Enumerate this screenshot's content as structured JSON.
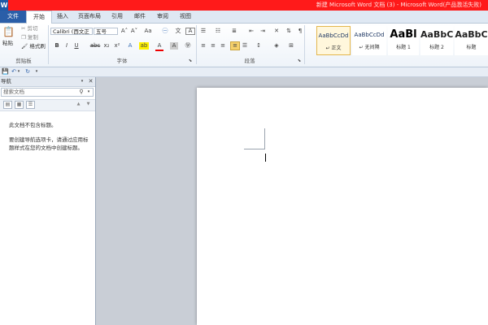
{
  "window": {
    "title": "新建 Microsoft Word 文档 (3) - Microsoft Word(产品激活失败)",
    "app_icon": "W"
  },
  "tabs": [
    "文件",
    "开始",
    "插入",
    "页面布局",
    "引用",
    "邮件",
    "审阅",
    "视图"
  ],
  "ribbon": {
    "clipboard": {
      "paste": "粘贴",
      "cut": "剪切",
      "copy": "复制",
      "format_painter": "格式刷",
      "group": "剪贴板"
    },
    "font": {
      "name": "Calibri (西文正",
      "size": "五号",
      "grow": "A˄",
      "shrink": "A˅",
      "case": "Aa",
      "clear": "A",
      "bold": "B",
      "italic": "I",
      "underline": "U",
      "strike": "abc",
      "sub": "x₂",
      "sup": "x²",
      "effects": "A",
      "highlight": "ab",
      "color": "A",
      "char_shade": "A",
      "group": "字体"
    },
    "paragraph": {
      "group": "段落"
    },
    "styles": [
      {
        "sample": "AaBbCcDd",
        "name": "↵ 正文"
      },
      {
        "sample": "AaBbCcDd",
        "name": "↵ 无间隔"
      },
      {
        "sample": "AaBl",
        "name": "标题 1"
      },
      {
        "sample": "AaBbC",
        "name": "标题 2"
      },
      {
        "sample": "AaBbC",
        "name": "标题"
      }
    ]
  },
  "nav": {
    "title": "导航",
    "search_placeholder": "搜索文档",
    "message1": "此文档不包含标题。",
    "message2": "要创建导航选项卡，请通过应用标题样式在您的文档中创建标题。"
  }
}
